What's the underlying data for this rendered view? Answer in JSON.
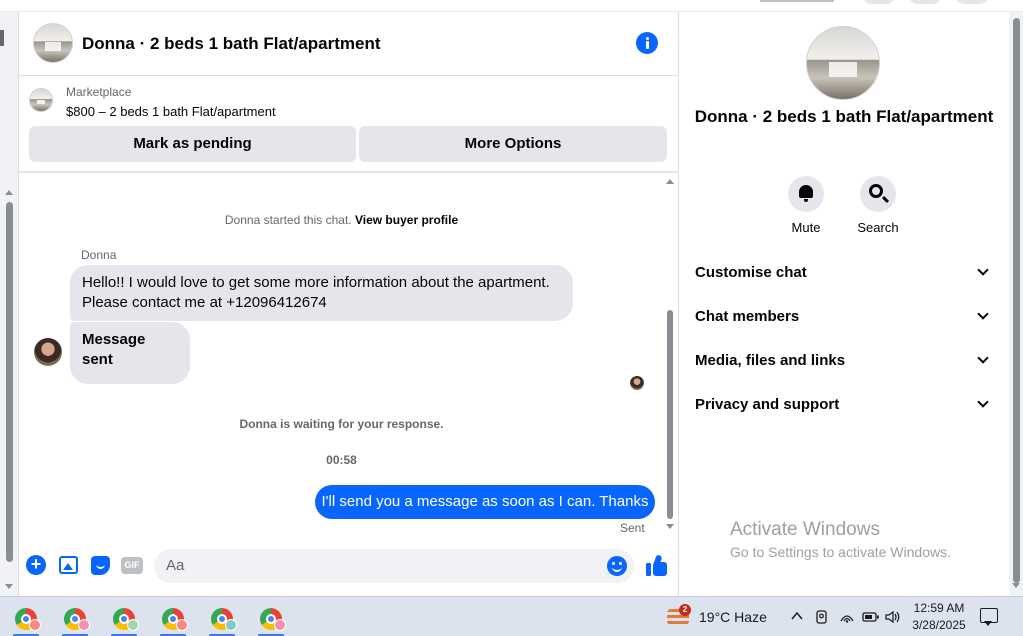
{
  "chat": {
    "header_title": "Donna · 2 beds 1 bath Flat/apartment",
    "marketplace_label": "Marketplace",
    "listing": "$800 – 2 beds 1 bath Flat/apartment",
    "mark_pending": "Mark as pending",
    "more_options": "More Options"
  },
  "messages": {
    "started_prefix": "Donna started this chat.",
    "view_profile": "View buyer profile",
    "sender": "Donna",
    "incoming_1": "Hello!! I would love to get some more information about the apartment. Please contact me at +12096412674",
    "incoming_2": "Message sent",
    "waiting": "Donna is waiting for your response.",
    "timestamp": "00:58",
    "outgoing_1": "I'll send you a message as soon as I can. Thanks",
    "status": "Sent"
  },
  "composer": {
    "placeholder": "Aa",
    "gif_label": "GIF",
    "plus_symbol": "+"
  },
  "info_panel": {
    "title": "Donna · 2 beds 1 bath Flat/apartment",
    "mute_label": "Mute",
    "search_label": "Search",
    "sections": [
      "Customise chat",
      "Chat members",
      "Media, files and links",
      "Privacy and support"
    ],
    "watermark_title": "Activate Windows",
    "watermark_sub": "Go to Settings to activate Windows."
  },
  "taskbar": {
    "apps": [
      {
        "badge_color": "#f28b82"
      },
      {
        "badge_color": "#f48fb1"
      },
      {
        "badge_color": "#a5d6a7"
      },
      {
        "badge_color": "#f28b82"
      },
      {
        "badge_color": "#80cbc4"
      },
      {
        "badge_color": "#f48fb1"
      }
    ],
    "weather_badge": "2",
    "weather": "19°C  Haze",
    "time": "12:59 AM",
    "date": "3/28/2025"
  },
  "colors": {
    "accent": "#0866ff",
    "bubble_in": "#e4e6eb"
  }
}
